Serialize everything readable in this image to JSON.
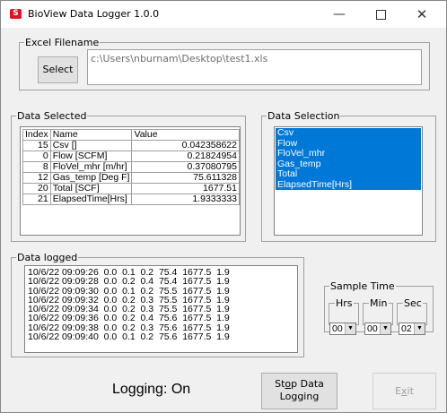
{
  "window": {
    "title": "BioView Data Logger 1.0.0",
    "icon_letter": "S",
    "minimize_glyph": "—",
    "close_glyph": "✕"
  },
  "excel": {
    "group_label": "Excel Filename",
    "select_label": "Select",
    "filename": "c:\\Users\\nburnam\\Desktop\\test1.xls"
  },
  "data_selected": {
    "group_label": "Data Selected",
    "columns": [
      "Index",
      "Name",
      "Value"
    ],
    "rows": [
      {
        "index": "15",
        "name": "Csv []",
        "value": "0.042358622"
      },
      {
        "index": "0",
        "name": "Flow [SCFM]",
        "value": "0.21824954"
      },
      {
        "index": "8",
        "name": "FloVel_mhr [m/hr]",
        "value": "0.37080795"
      },
      {
        "index": "12",
        "name": "Gas_temp [Deg F]",
        "value": "75.611328"
      },
      {
        "index": "20",
        "name": "Total [SCF]",
        "value": "1677.51"
      },
      {
        "index": "21",
        "name": "ElapsedTime[Hrs]",
        "value": "1.9333333"
      }
    ]
  },
  "data_selection": {
    "group_label": "Data Selection",
    "items": [
      "Csv",
      "Flow",
      "FloVel_mhr",
      "Gas_temp",
      "Total",
      "ElapsedTime[Hrs]"
    ],
    "highlight_color": "#0078d7"
  },
  "data_logged": {
    "group_label": "Data logged",
    "lines": [
      "10/6/22 09:09:26  0.0  0.1  0.2  75.4  1677.5  1.9",
      "10/6/22 09:09:28  0.0  0.2  0.4  75.4  1677.5  1.9",
      "10/6/22 09:09:30  0.0  0.1  0.2  75.5  1677.5  1.9",
      "10/6/22 09:09:32  0.0  0.2  0.3  75.5  1677.5  1.9",
      "10/6/22 09:09:34  0.0  0.2  0.3  75.5  1677.5  1.9",
      "10/6/22 09:09:36  0.0  0.2  0.4  75.6  1677.5  1.9",
      "10/6/22 09:09:38  0.0  0.2  0.3  75.6  1677.5  1.9",
      "10/6/22 09:09:40  0.0  0.1  0.2  75.6  1677.5  1.9"
    ]
  },
  "sample_time": {
    "group_label": "Sample Time",
    "hrs_label": "Hrs",
    "min_label": "Min",
    "sec_label": "Sec",
    "hrs_value": "00",
    "min_value": "00",
    "sec_value": "02"
  },
  "status": {
    "text": "Logging: On"
  },
  "buttons": {
    "stop_line1_pre": "St",
    "stop_line1_mnemonic": "o",
    "stop_line1_post": "p Data",
    "stop_line2": "Logging",
    "exit_pre": "E",
    "exit_mnemonic": "x",
    "exit_post": "it"
  }
}
